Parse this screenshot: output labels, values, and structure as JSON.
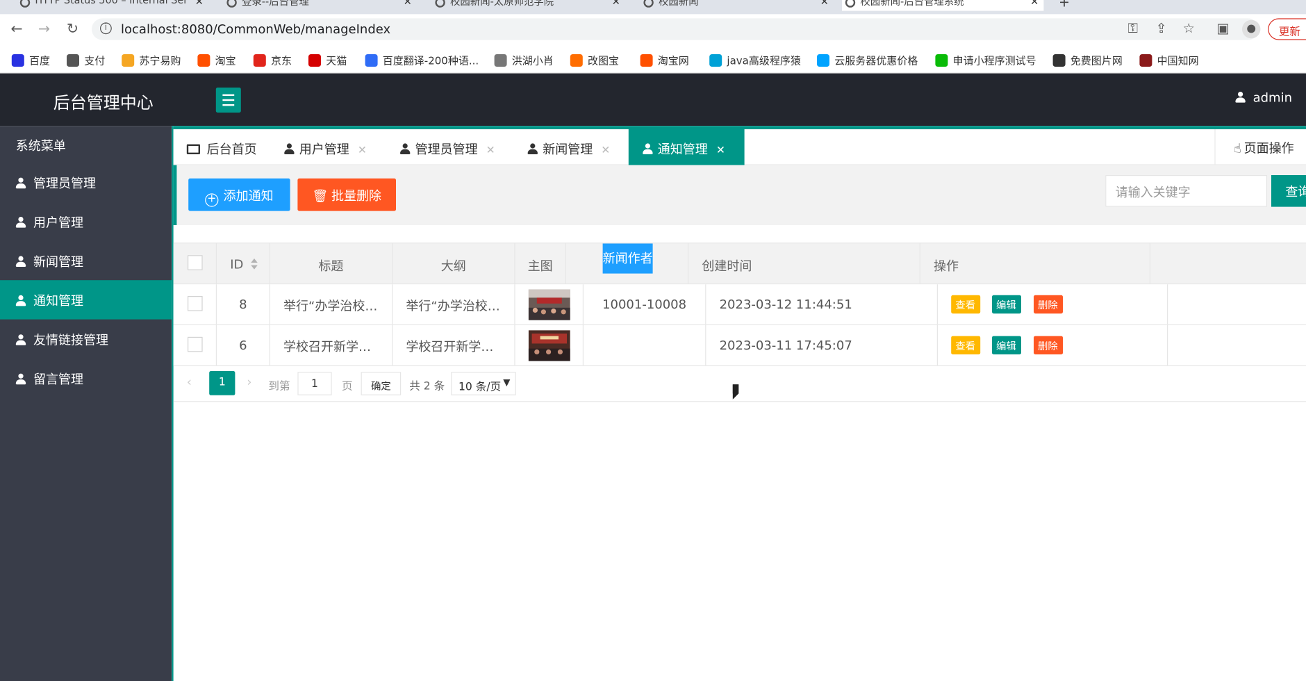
{
  "browser": {
    "tabs": [
      {
        "title": "HTTP Status 500 – Internal Ser"
      },
      {
        "title": "登录--后台管理"
      },
      {
        "title": "校园新闻-太原师范学院"
      },
      {
        "title": "校园新闻"
      },
      {
        "title": "校园新闻-后台管理系统"
      }
    ],
    "new_tab": "+",
    "url": "localhost:8080/CommonWeb/manageIndex",
    "update_label": "更新",
    "bookmarks": [
      {
        "label": "百度",
        "color": "#2932e1"
      },
      {
        "label": "支付",
        "color": "#555555"
      },
      {
        "label": "苏宁易购",
        "color": "#f5a623"
      },
      {
        "label": "淘宝",
        "color": "#ff5000"
      },
      {
        "label": "京东",
        "color": "#e1251b"
      },
      {
        "label": "天猫",
        "color": "#d50000"
      },
      {
        "label": "百度翻译-200种语...",
        "color": "#2f6cf6"
      },
      {
        "label": "洪湖小肖",
        "color": "#777777"
      },
      {
        "label": "改图宝",
        "color": "#ff6d00"
      },
      {
        "label": "淘宝网",
        "color": "#ff5000"
      },
      {
        "label": "java高级程序猿",
        "color": "#00a1d6"
      },
      {
        "label": "云服务器优惠价格",
        "color": "#00a3ff"
      },
      {
        "label": "申请小程序测试号",
        "color": "#09bb07"
      },
      {
        "label": "免费图片网",
        "color": "#333333"
      },
      {
        "label": "中国知网",
        "color": "#8b1a1a"
      }
    ]
  },
  "header": {
    "brand": "后台管理中心",
    "user": "admin"
  },
  "sidebar": {
    "title": "系统菜单",
    "items": [
      {
        "label": "管理员管理"
      },
      {
        "label": "用户管理"
      },
      {
        "label": "新闻管理"
      },
      {
        "label": "通知管理"
      },
      {
        "label": "友情链接管理"
      },
      {
        "label": "留言管理"
      }
    ]
  },
  "page_tabs": [
    {
      "label": "后台首页"
    },
    {
      "label": "用户管理"
    },
    {
      "label": "管理员管理"
    },
    {
      "label": "新闻管理"
    },
    {
      "label": "通知管理"
    }
  ],
  "page_op": "页面操作",
  "toolbar": {
    "add": "添加通知",
    "batch_delete": "批量删除",
    "search_placeholder": "请输入关键字",
    "search_btn": "查询"
  },
  "table": {
    "columns": [
      "ID",
      "标题",
      "大纲",
      "主图",
      "新闻作者",
      "创建时间",
      "操作"
    ],
    "rows": [
      {
        "id": "8",
        "title": "举行“办学治校…",
        "outline": "举行“办学治校…",
        "author": "10001-10008",
        "created": "2023-03-12 11:44:51"
      },
      {
        "id": "6",
        "title": "学校召开新学…",
        "outline": "学校召开新学…",
        "author": "",
        "created": "2023-03-11 17:45:07"
      }
    ],
    "actions": {
      "view": "查看",
      "edit": "编辑",
      "delete": "删除"
    }
  },
  "pagination": {
    "current": "1",
    "goto": "到第",
    "page_input": "1",
    "page_unit": "页",
    "confirm": "确定",
    "total": "共 2 条",
    "page_size": "10 条/页"
  },
  "colors": {
    "accent": "#009688",
    "blue": "#1e9fff",
    "orange": "#ff5722",
    "yellow": "#ffb800",
    "sidebar": "#393d49",
    "topbar": "#23262e"
  }
}
